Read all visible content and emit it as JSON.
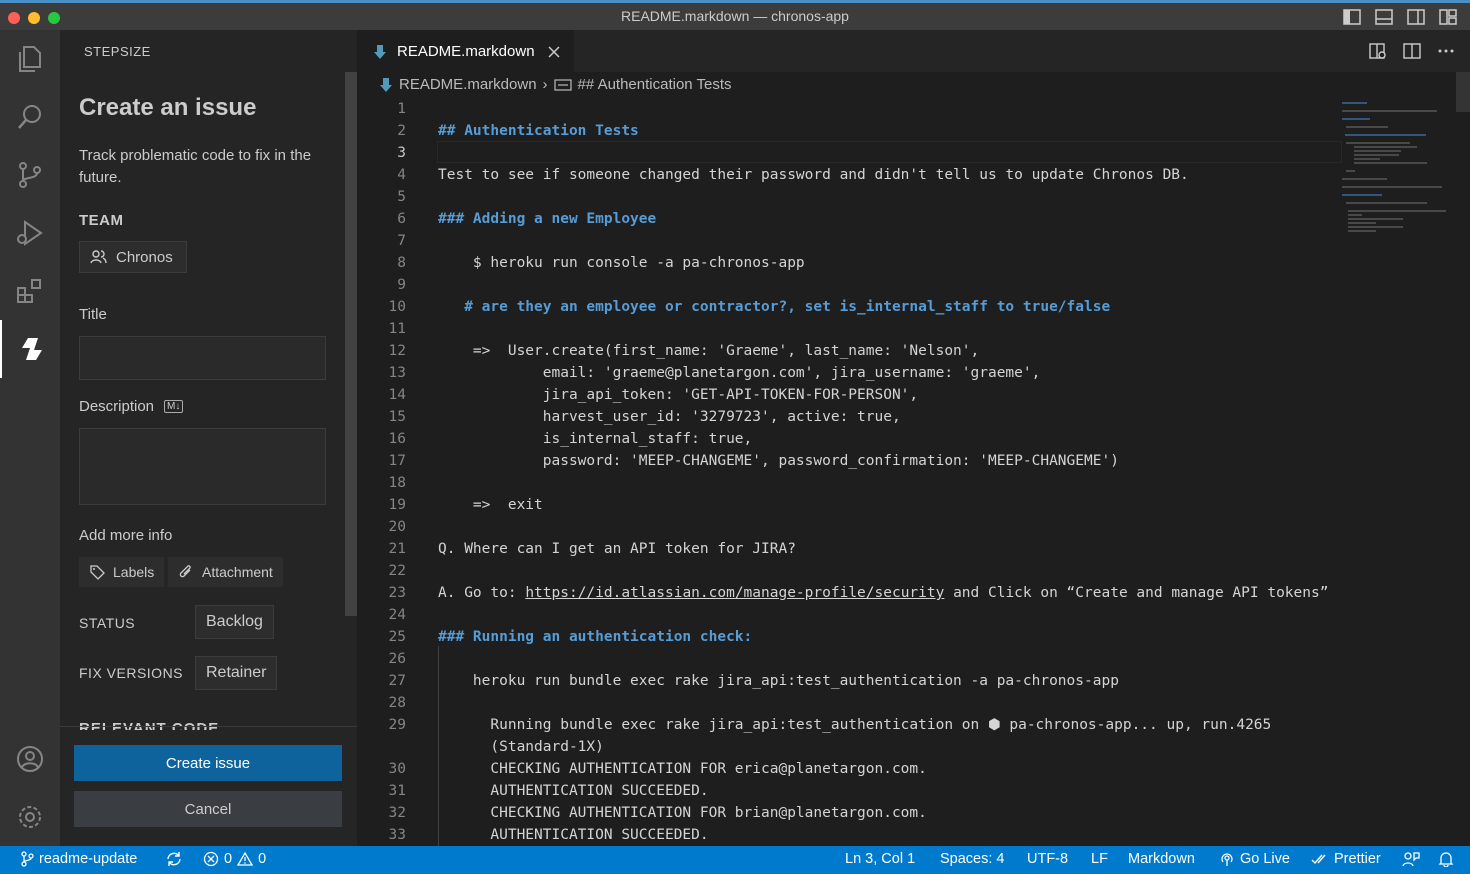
{
  "window": {
    "title": "README.markdown — chronos-app"
  },
  "sidebar": {
    "header": "STEPSIZE",
    "issue_title": "Create an issue",
    "issue_desc": "Track problematic code to fix in the future.",
    "team_label": "TEAM",
    "team_value": "Chronos",
    "title_label": "Title",
    "title_value": "",
    "description_label": "Description",
    "md_badge": "M↓",
    "add_more_label": "Add more info",
    "labels_button": "Labels",
    "attachment_button": "Attachment",
    "status_label": "STATUS",
    "status_value": "Backlog",
    "fix_versions_label": "FIX VERSIONS",
    "fix_versions_value": "Retainer",
    "relevant_code_label": "RELEVANT CODE",
    "create_button": "Create issue",
    "cancel_button": "Cancel"
  },
  "editor": {
    "tab_label": "README.markdown",
    "breadcrumb_file": "README.markdown",
    "breadcrumb_symbol": "## Authentication Tests",
    "current_line": 3,
    "lines": [
      {
        "n": "1",
        "t": "",
        "k": "text"
      },
      {
        "n": "2",
        "t": "## Authentication Tests",
        "k": "heading"
      },
      {
        "n": "3",
        "t": "",
        "k": "text"
      },
      {
        "n": "4",
        "t": "Test to see if someone changed their password and didn't tell us to update Chronos DB.",
        "k": "text"
      },
      {
        "n": "5",
        "t": "",
        "k": "text"
      },
      {
        "n": "6",
        "t": "### Adding a new Employee",
        "k": "heading"
      },
      {
        "n": "7",
        "t": "",
        "k": "text"
      },
      {
        "n": "8",
        "t": "    $ heroku run console -a pa-chronos-app",
        "k": "text"
      },
      {
        "n": "9",
        "t": "",
        "k": "text"
      },
      {
        "n": "10",
        "t": "   # are they an employee or contractor?, set is_internal_staff to true/false",
        "k": "heading"
      },
      {
        "n": "11",
        "t": "",
        "k": "text"
      },
      {
        "n": "12",
        "t": "    =>  User.create(first_name: 'Graeme', last_name: 'Nelson',",
        "k": "text"
      },
      {
        "n": "13",
        "t": "            email: 'graeme@planetargon.com', jira_username: 'graeme',",
        "k": "text"
      },
      {
        "n": "14",
        "t": "            jira_api_token: 'GET-API-TOKEN-FOR-PERSON',",
        "k": "text"
      },
      {
        "n": "15",
        "t": "            harvest_user_id: '3279723', active: true,",
        "k": "text"
      },
      {
        "n": "16",
        "t": "            is_internal_staff: true,",
        "k": "text"
      },
      {
        "n": "17",
        "t": "            password: 'MEEP-CHANGEME', password_confirmation: 'MEEP-CHANGEME')",
        "k": "text"
      },
      {
        "n": "18",
        "t": "",
        "k": "text"
      },
      {
        "n": "19",
        "t": "    =>  exit",
        "k": "text"
      },
      {
        "n": "20",
        "t": "",
        "k": "text"
      },
      {
        "n": "21",
        "t": "Q. Where can I get an API token for JIRA?",
        "k": "text"
      },
      {
        "n": "22",
        "t": "",
        "k": "text"
      },
      {
        "n": "23",
        "t": "A. Go to: ",
        "link": "https://id.atlassian.com/manage-profile/security",
        "after": " and Click on “Create and manage API tokens”",
        "k": "link"
      },
      {
        "n": "24",
        "t": "",
        "k": "text"
      },
      {
        "n": "25",
        "t": "### Running an authentication check:",
        "k": "heading"
      },
      {
        "n": "26",
        "t": "",
        "k": "text"
      },
      {
        "n": "27",
        "t": "    heroku run bundle exec rake jira_api:test_authentication -a pa-chronos-app",
        "k": "text"
      },
      {
        "n": "28",
        "t": "",
        "k": "text"
      },
      {
        "n": "29",
        "t": "      Running bundle exec rake jira_api:test_authentication on ⬢ pa-chronos-app... up, run.4265",
        "k": "text"
      },
      {
        "n": "",
        "t": "      (Standard-1X)",
        "k": "text"
      },
      {
        "n": "30",
        "t": "      CHECKING AUTHENTICATION FOR erica@planetargon.com.",
        "k": "text"
      },
      {
        "n": "31",
        "t": "      AUTHENTICATION SUCCEEDED.",
        "k": "text"
      },
      {
        "n": "32",
        "t": "      CHECKING AUTHENTICATION FOR brian@planetargon.com.",
        "k": "text"
      },
      {
        "n": "33",
        "t": "      AUTHENTICATION SUCCEEDED.",
        "k": "text"
      }
    ]
  },
  "statusbar": {
    "branch": "readme-update",
    "errors": "0",
    "warnings": "0",
    "position": "Ln 3, Col 1",
    "spaces": "Spaces: 4",
    "encoding": "UTF-8",
    "eol": "LF",
    "language": "Markdown",
    "golive": "Go Live",
    "prettier": "Prettier"
  },
  "colors": {
    "accent": "#007acc",
    "primary_button": "#0e639c",
    "heading": "#569cd6"
  }
}
